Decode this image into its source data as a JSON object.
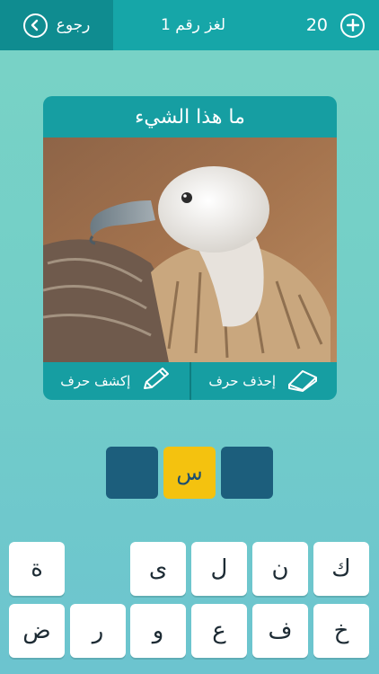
{
  "header": {
    "back_label": "رجوع",
    "title": "لغز رقم 1",
    "coins": "20"
  },
  "card": {
    "title": "ما هذا الشيء",
    "reveal_label": "إكشف حرف",
    "remove_label": "إحذف حرف"
  },
  "answer": [
    "",
    "س",
    ""
  ],
  "keyboard": {
    "row1": [
      "ك",
      "ن",
      "ل",
      "ى",
      "ة"
    ],
    "row2": [
      "خ",
      "ف",
      "ع",
      "و",
      "ر",
      "ض"
    ]
  },
  "colors": {
    "topbar": "#16a6a8",
    "back": "#0f8c90",
    "slot": "#1c5e7c",
    "slot_filled": "#f4c20f"
  }
}
